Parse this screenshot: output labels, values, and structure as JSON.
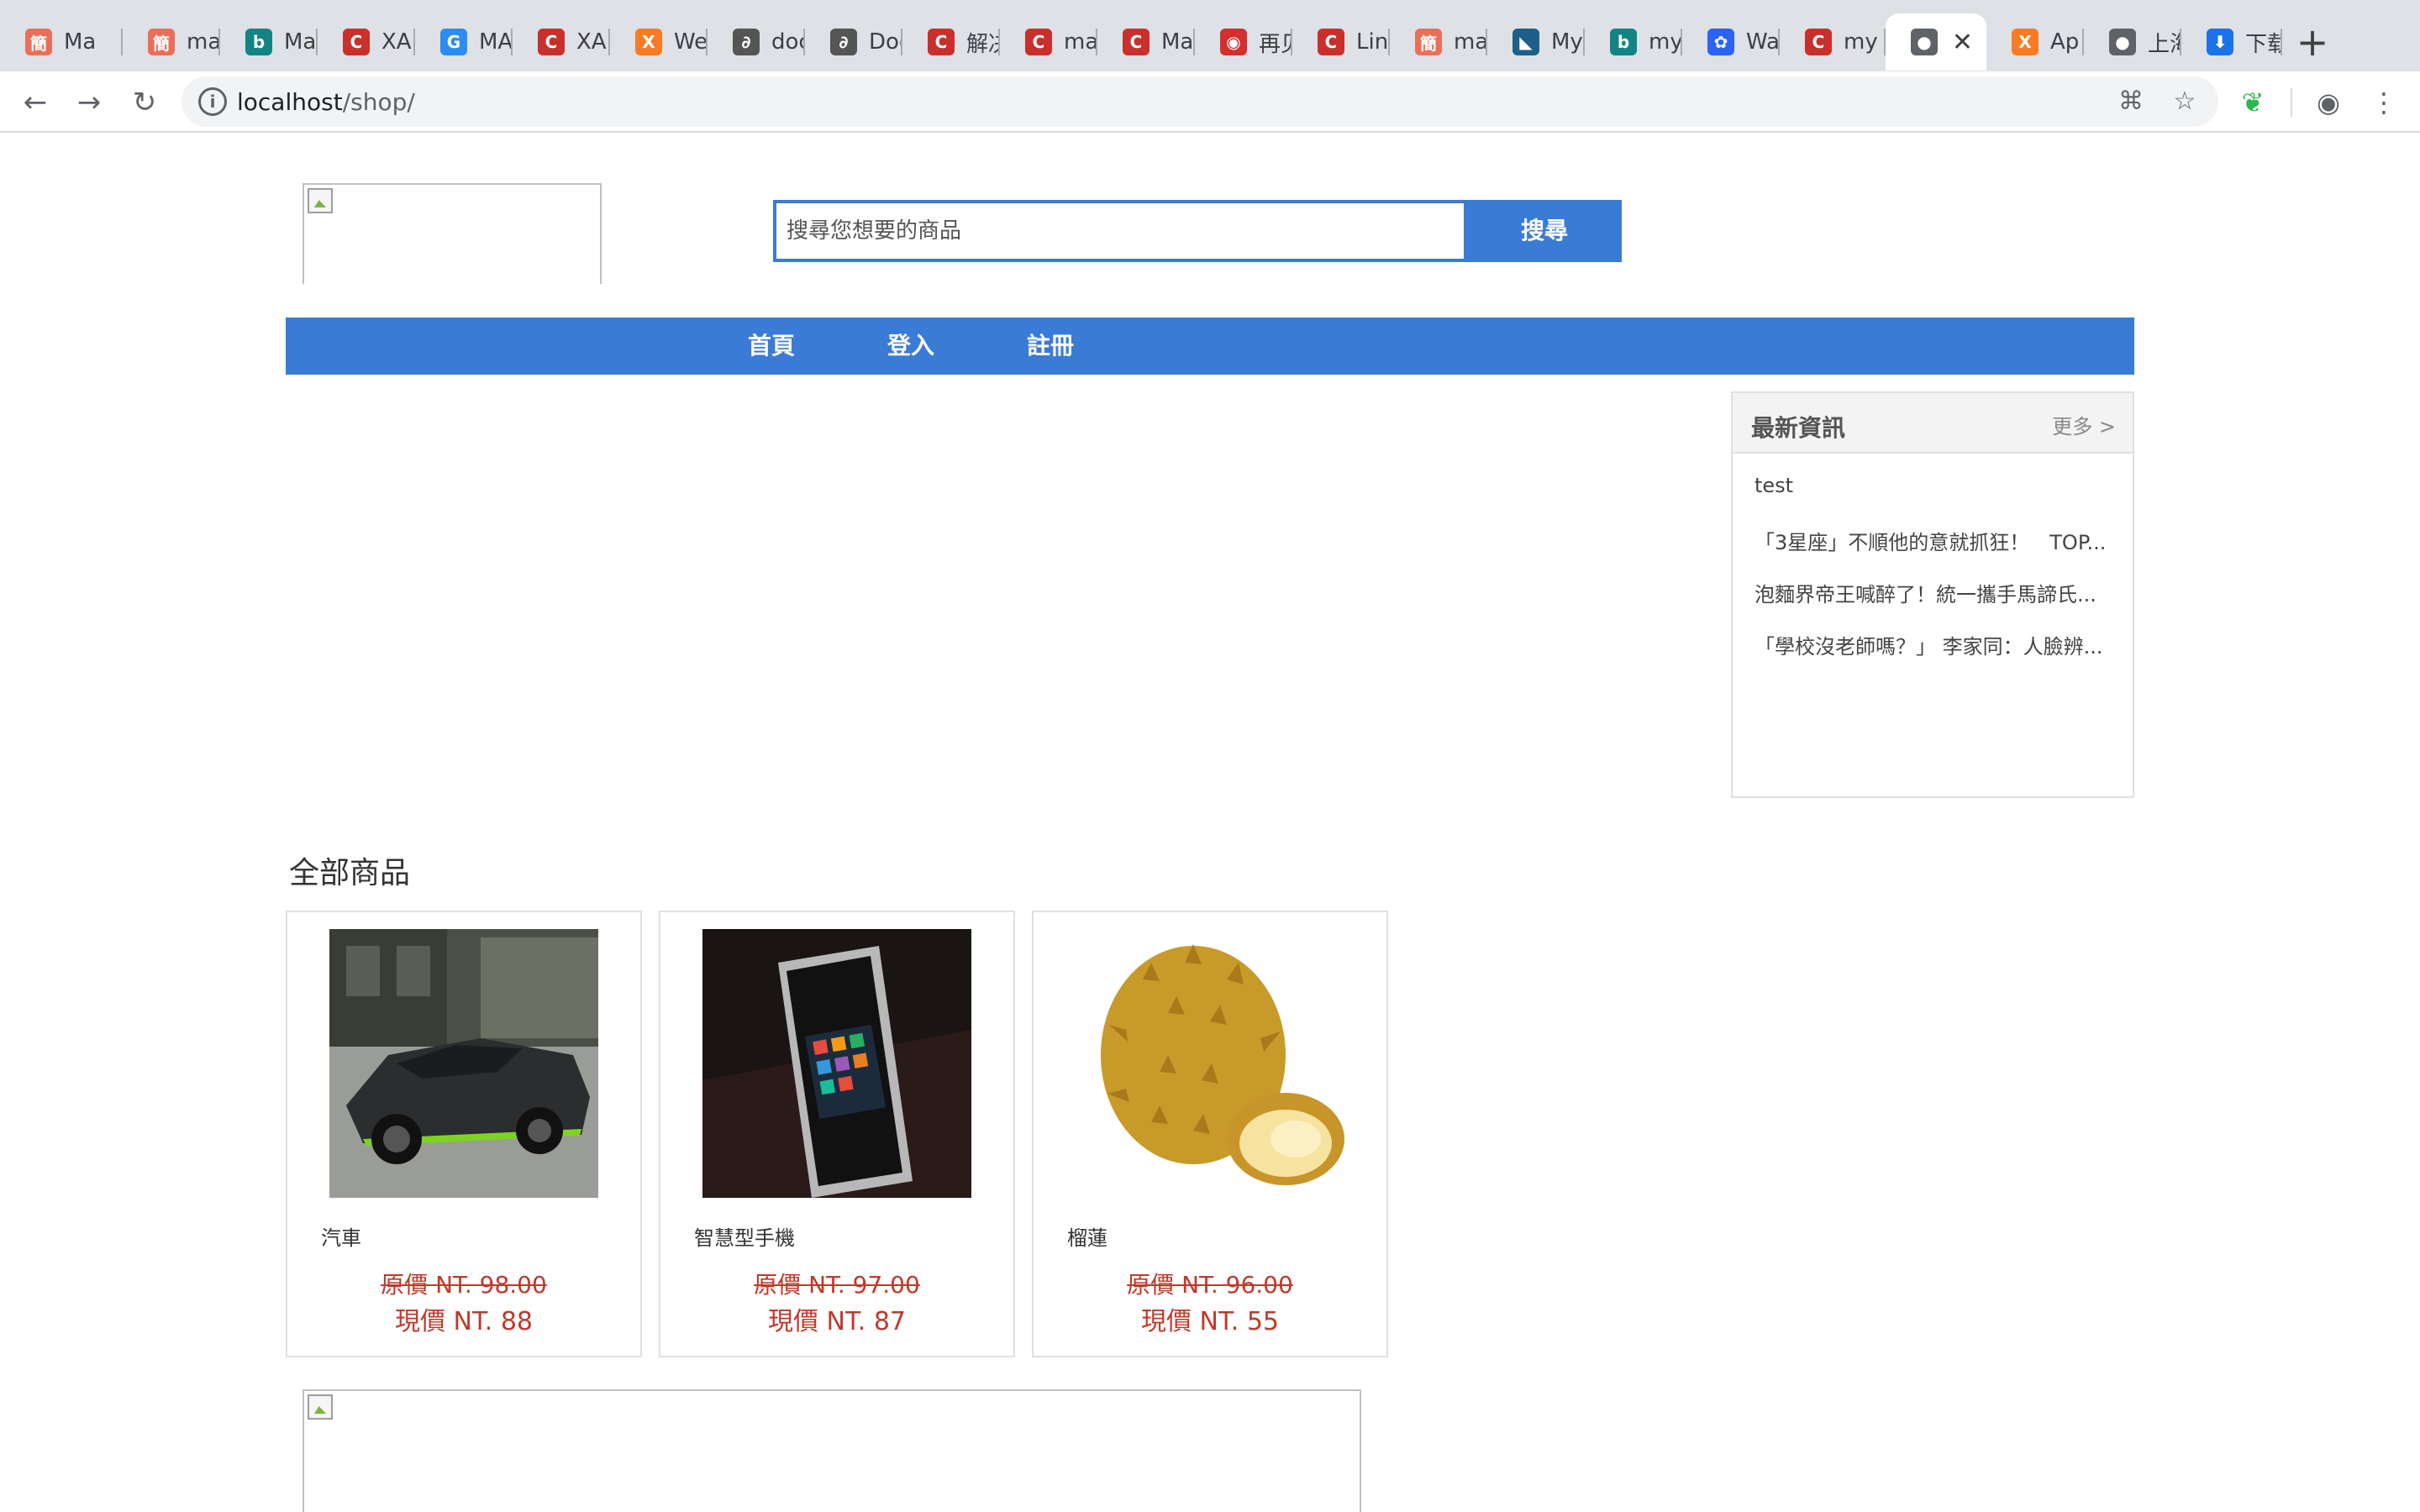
{
  "browser": {
    "tabs": [
      {
        "label": "Ma",
        "icon": "jianshu-icon",
        "color": "#ea6f5a",
        "glyph": "簡"
      },
      {
        "label": "ma",
        "icon": "jianshu-icon",
        "color": "#ea6f5a",
        "glyph": "簡"
      },
      {
        "label": "Ma",
        "icon": "bing-icon",
        "color": "#138484",
        "glyph": "b"
      },
      {
        "label": "XAI",
        "icon": "csdn-icon",
        "color": "#c9302c",
        "glyph": "C"
      },
      {
        "label": "MA",
        "icon": "globe-blue-icon",
        "color": "#2d8cf0",
        "glyph": "G"
      },
      {
        "label": "XAI",
        "icon": "csdn-icon",
        "color": "#c9302c",
        "glyph": "C"
      },
      {
        "label": "We",
        "icon": "xampp-icon",
        "color": "#fb7a24",
        "glyph": "X"
      },
      {
        "label": "doc",
        "icon": "docs-icon",
        "color": "#555555",
        "glyph": "∂"
      },
      {
        "label": "Doc",
        "icon": "docs-icon",
        "color": "#555555",
        "glyph": "∂"
      },
      {
        "label": "解决",
        "icon": "csdn-icon",
        "color": "#c9302c",
        "glyph": "C"
      },
      {
        "label": "mac",
        "icon": "csdn-icon",
        "color": "#c9302c",
        "glyph": "C"
      },
      {
        "label": "Ma",
        "icon": "csdn-icon",
        "color": "#c9302c",
        "glyph": "C"
      },
      {
        "label": "再见",
        "icon": "eye-icon",
        "color": "#d32f2f",
        "glyph": "◉"
      },
      {
        "label": "Lin",
        "icon": "csdn-icon",
        "color": "#c9302c",
        "glyph": "C"
      },
      {
        "label": "ma",
        "icon": "jianshu-icon",
        "color": "#ea6f5a",
        "glyph": "簡"
      },
      {
        "label": "My",
        "icon": "mysql-icon",
        "color": "#1e5f8a",
        "glyph": "◣"
      },
      {
        "label": "my",
        "icon": "bing-icon",
        "color": "#138484",
        "glyph": "b"
      },
      {
        "label": "Wa",
        "icon": "baidu-icon",
        "color": "#2b63f6",
        "glyph": "✿"
      },
      {
        "label": "my",
        "icon": "csdn-icon",
        "color": "#c9302c",
        "glyph": "C"
      },
      {
        "label": "",
        "icon": "globe-icon",
        "color": "#5f6368",
        "glyph": "●",
        "active": true
      },
      {
        "label": "Ap",
        "icon": "xampp-icon",
        "color": "#fb7a24",
        "glyph": "X"
      },
      {
        "label": "上海",
        "icon": "globe-icon",
        "color": "#5f6368",
        "glyph": "●"
      },
      {
        "label": "下载",
        "icon": "download-icon",
        "color": "#1a73e8",
        "glyph": "⬇"
      }
    ],
    "address": {
      "host": "localhost",
      "path": "/shop/"
    }
  },
  "site": {
    "search": {
      "placeholder": "搜尋您想要的商品",
      "button": "搜尋"
    },
    "nav": [
      "首頁",
      "登入",
      "註冊"
    ],
    "news": {
      "title": "最新資訊",
      "more": "更多 >",
      "items": [
        "test",
        "「3星座」不順他的意就抓狂！　TOP...",
        "泡麵界帝王喊醉了！統一攜手馬諦氏...",
        "「學校沒老師嗎？」 李家同：人臉辨..."
      ]
    },
    "products_title": "全部商品",
    "products": [
      {
        "name": "汽車",
        "old_price": "原價 NT. 98.00",
        "new_price": "現價 NT. 88",
        "image": "car-image"
      },
      {
        "name": "智慧型手機",
        "old_price": "原價 NT. 97.00",
        "new_price": "現價 NT. 87",
        "image": "phone-image"
      },
      {
        "name": "榴蓮",
        "old_price": "原價 NT. 96.00",
        "new_price": "現價 NT. 55",
        "image": "durian-image"
      }
    ]
  }
}
